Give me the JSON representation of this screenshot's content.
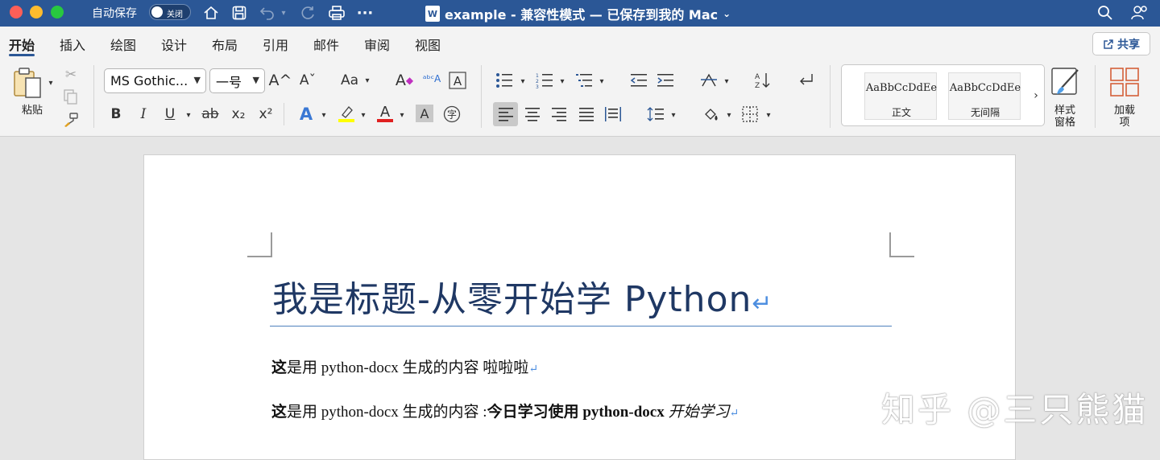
{
  "titlebar": {
    "autosave_label": "自动保存",
    "autosave_toggle": "关闭",
    "doc_icon": "W",
    "doc_title": "example  -  兼容性模式 — 已保存到我的 Mac",
    "title_chevron": "⌄"
  },
  "menu": {
    "tabs": [
      "开始",
      "插入",
      "绘图",
      "设计",
      "布局",
      "引用",
      "邮件",
      "审阅",
      "视图"
    ],
    "share_label": "共享"
  },
  "ribbon": {
    "paste_label": "粘贴",
    "font_name": "MS Gothic...",
    "font_size": "一号",
    "bold": "B",
    "italic": "I",
    "underline": "U",
    "strikethrough": "ab",
    "subscript": "x₂",
    "superscript": "x²",
    "change_case": "Aa",
    "grow_font": "A^",
    "shrink_font": "Aˇ",
    "styles": [
      {
        "sample": "AaBbCcDdEe",
        "name": "正文"
      },
      {
        "sample": "AaBbCcDdEe",
        "name": "无间隔"
      }
    ],
    "styles_pane_label": "样式\n窗格",
    "addins_label": "加载\n项"
  },
  "document": {
    "heading": "我是标题-从零开始学 Python",
    "para1": {
      "bold": "这",
      "rest": "是用 python-docx 生成的内容 啦啦啦"
    },
    "para2": {
      "bold1": "这",
      "normal": "是用 python-docx 生成的内容 :",
      "bold2": "今日学习使用 python-docx",
      "italic": " 开始学习"
    },
    "return_mark": "↵"
  },
  "watermark": "知乎 @三只熊猫",
  "colors": {
    "titlebar": "#2b5796",
    "heading": "#1f3864",
    "rule": "#4f81bd",
    "highlight": "#ffff00",
    "font_color": "#e02020"
  }
}
